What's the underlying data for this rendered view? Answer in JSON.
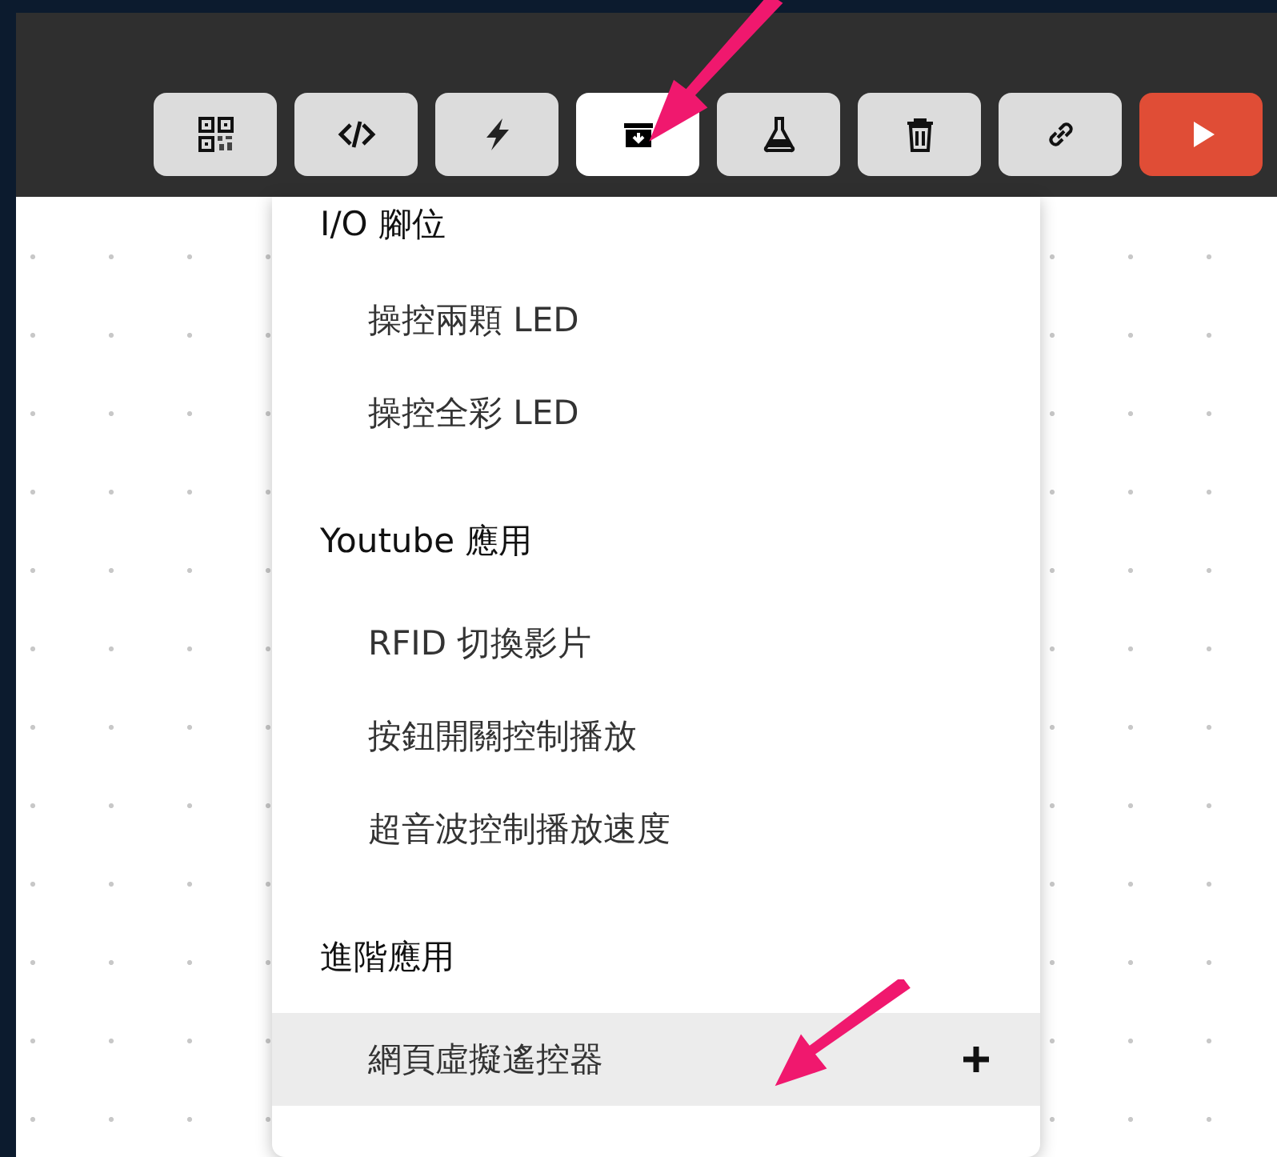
{
  "toolbar": {
    "buttons": [
      {
        "kind": "qr",
        "selected": false
      },
      {
        "kind": "code",
        "selected": false
      },
      {
        "kind": "bolt",
        "selected": false
      },
      {
        "kind": "archive",
        "selected": true
      },
      {
        "kind": "flask",
        "selected": false
      },
      {
        "kind": "trash",
        "selected": false
      },
      {
        "kind": "link",
        "selected": false
      },
      {
        "kind": "run",
        "selected": false
      }
    ]
  },
  "menu": {
    "items": [
      {
        "kind": "header",
        "label": "I/O 腳位"
      },
      {
        "kind": "item",
        "label": "操控兩顆 LED",
        "selected": false
      },
      {
        "kind": "item",
        "label": "操控全彩 LED",
        "selected": false
      },
      {
        "kind": "header",
        "label": "Youtube 應用"
      },
      {
        "kind": "item",
        "label": "RFID 切換影片",
        "selected": false
      },
      {
        "kind": "item",
        "label": "按鈕開關控制播放",
        "selected": false
      },
      {
        "kind": "item",
        "label": "超音波控制播放速度",
        "selected": false
      },
      {
        "kind": "header",
        "label": "進階應用"
      },
      {
        "kind": "item",
        "label": "網頁虛擬遙控器",
        "selected": true
      }
    ]
  }
}
